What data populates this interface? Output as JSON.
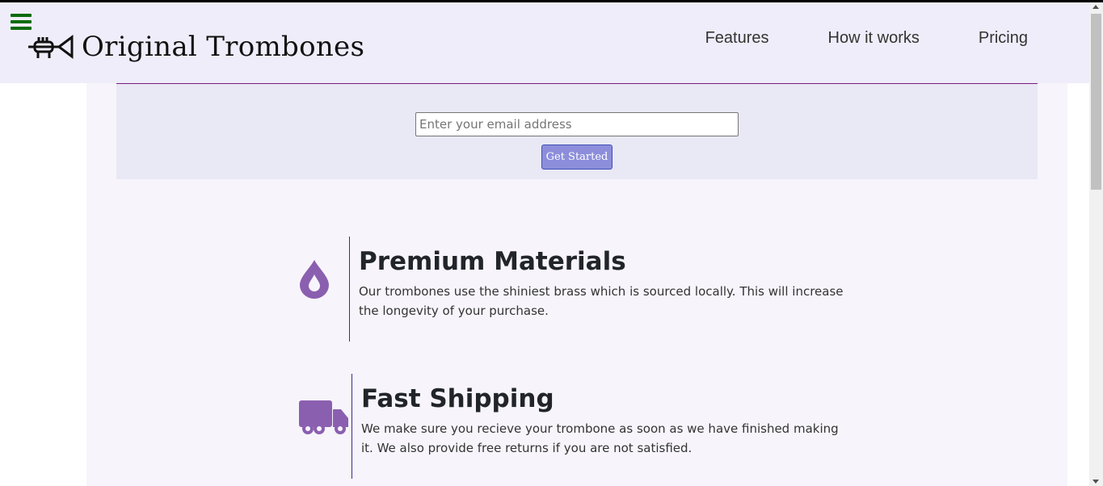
{
  "header": {
    "brand": "Original Trombones",
    "logo_icon": "trumpet-icon",
    "menu_icon": "hamburger-menu-icon",
    "nav": [
      {
        "label": "Features"
      },
      {
        "label": "How it works"
      },
      {
        "label": "Pricing"
      }
    ]
  },
  "hero": {
    "email_placeholder": "Enter your email address",
    "email_value": "",
    "cta_label": "Get Started"
  },
  "features": [
    {
      "icon": "droplet-icon",
      "title": "Premium Materials",
      "text": "Our trombones use the shiniest brass which is sourced locally. This will increase the longevity of your purchase."
    },
    {
      "icon": "truck-icon",
      "title": "Fast Shipping",
      "text": "We make sure you recieve your trombone as soon as we have finished making it. We also provide free returns if you are not satisfied."
    }
  ],
  "colors": {
    "header_bg": "#efedf9",
    "content_bg": "#f7f5fb",
    "hero_bg": "#e9e8f5",
    "accent_purple": "#8b5fb0",
    "button_bg": "#8c8edb",
    "hamburger": "#0b6b0b"
  }
}
